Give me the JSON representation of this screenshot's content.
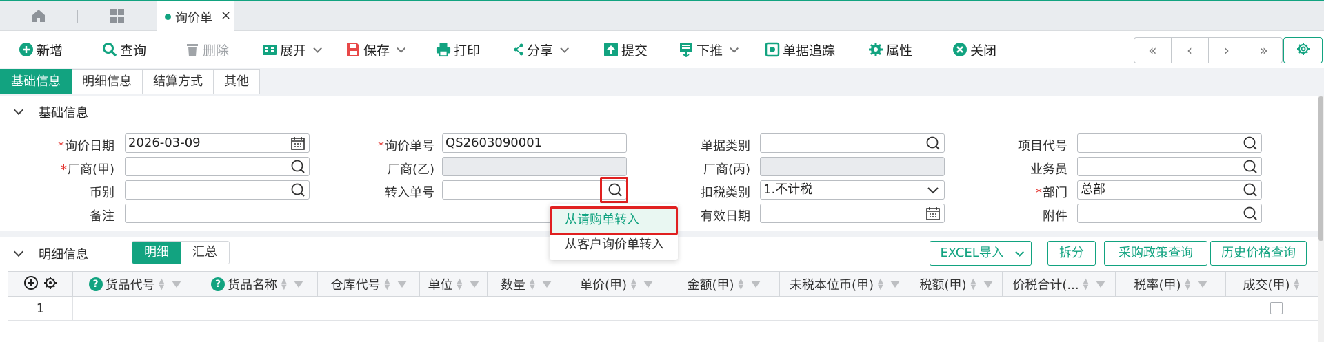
{
  "tabbar": {
    "page_tab_label": "询价单",
    "close_symbol": "×"
  },
  "toolbar": {
    "new": "新增",
    "query": "查询",
    "delete": "删除",
    "expand": "展开",
    "save": "保存",
    "print": "打印",
    "share": "分享",
    "submit": "提交",
    "push_down": "下推",
    "trace": "单据追踪",
    "properties": "属性",
    "close": "关闭"
  },
  "section_tabs": [
    "基础信息",
    "明细信息",
    "结算方式",
    "其他"
  ],
  "basic": {
    "title": "基础信息",
    "fields": {
      "inquiry_date": {
        "label": "询价日期",
        "value": "2026-03-09"
      },
      "inquiry_no": {
        "label": "询价单号",
        "value": "QS2603090001"
      },
      "doc_type": {
        "label": "单据类别",
        "value": ""
      },
      "project_code": {
        "label": "项目代号",
        "value": ""
      },
      "vendor_a": {
        "label": "厂商(甲)",
        "value": ""
      },
      "vendor_b": {
        "label": "厂商(乙)",
        "value": ""
      },
      "vendor_c": {
        "label": "厂商(丙)",
        "value": ""
      },
      "salesman": {
        "label": "业务员",
        "value": ""
      },
      "currency": {
        "label": "币别",
        "value": ""
      },
      "transfer_no": {
        "label": "转入单号",
        "value": ""
      },
      "tax_type": {
        "label": "扣税类别",
        "value": "1.不计税"
      },
      "department": {
        "label": "部门",
        "value": "总部"
      },
      "remark": {
        "label": "备注",
        "value": ""
      },
      "valid_date": {
        "label": "有效日期",
        "value": ""
      },
      "attachment": {
        "label": "附件",
        "value": ""
      }
    },
    "required_mark": "*"
  },
  "dropdown": {
    "items": [
      "从请购单转入",
      "从客户询价单转入"
    ]
  },
  "detail": {
    "title": "明细信息",
    "segments": [
      "明细",
      "汇总"
    ],
    "buttons": {
      "excel": "EXCEL导入",
      "split": "拆分",
      "policy": "采购政策查询",
      "history": "历史价格查询"
    },
    "columns": [
      "货品代号",
      "货品名称",
      "仓库代号",
      "单位",
      "数量",
      "单价(甲)",
      "金额(甲)",
      "未税本位币(甲)",
      "税额(甲)",
      "价税合计(...",
      "税率(甲)",
      "成交(甲)"
    ],
    "rows": [
      {
        "no": "1"
      }
    ]
  },
  "colors": {
    "accent": "#12a380",
    "highlight": "#e02020"
  }
}
